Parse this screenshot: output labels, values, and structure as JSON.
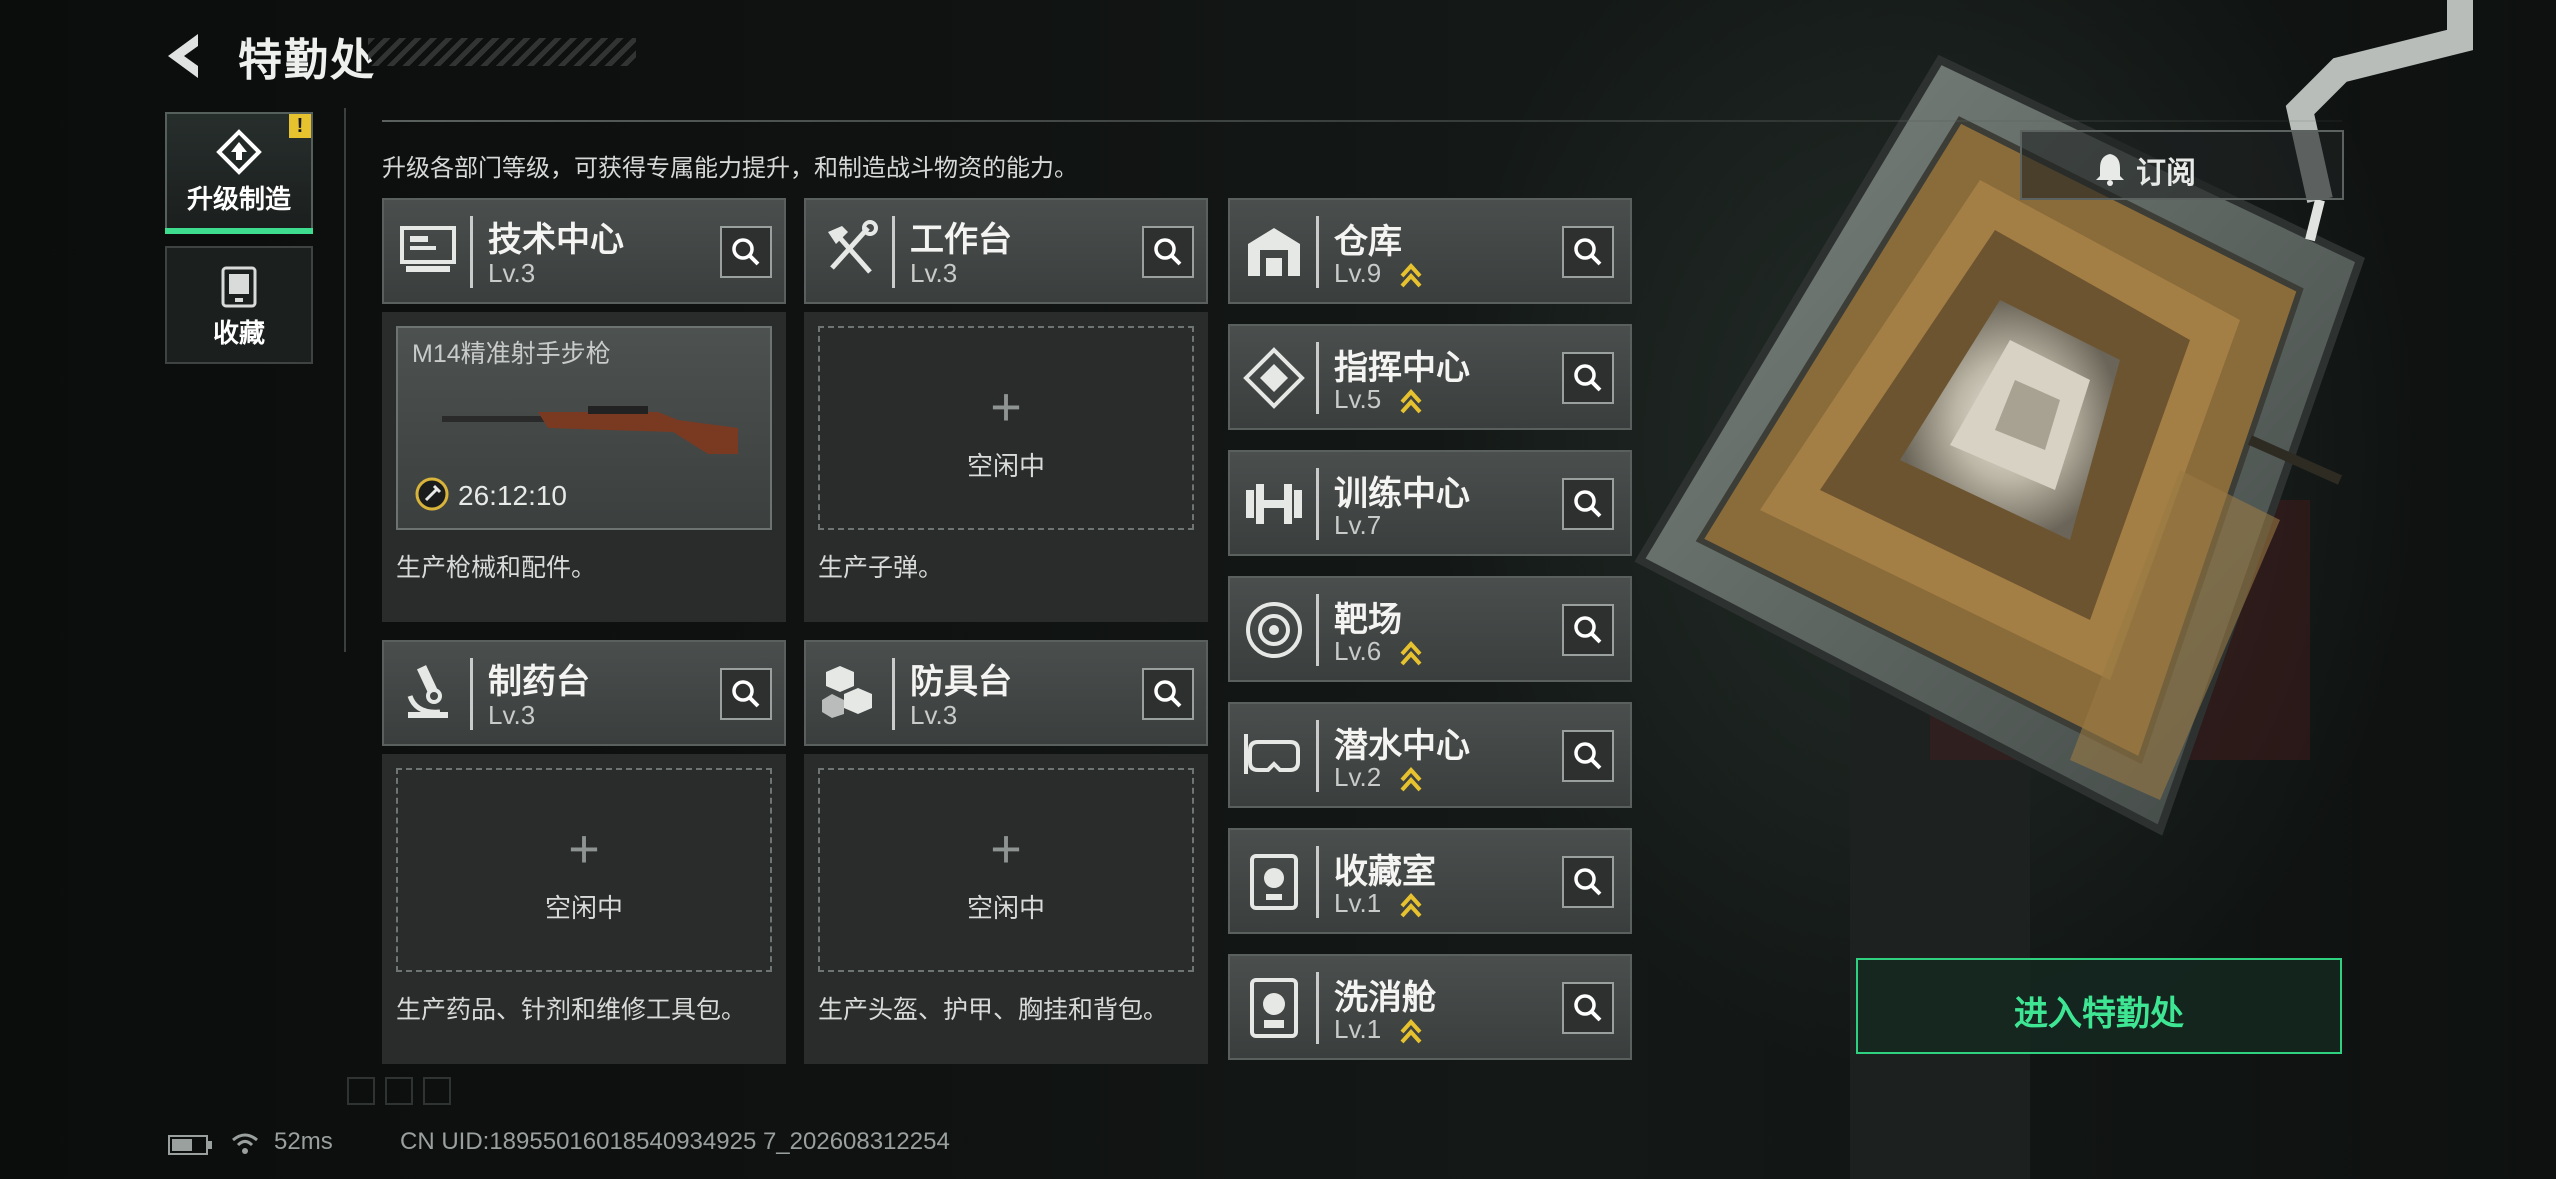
{
  "header": {
    "title": "特勤处"
  },
  "sidebar": {
    "tabs": [
      {
        "label": "升级制造",
        "active": true,
        "alert": "!"
      },
      {
        "label": "收藏",
        "active": false
      }
    ]
  },
  "description": "升级各部门等级，可获得专属能力提升，和制造战斗物资的能力。",
  "workshops": [
    {
      "name": "技术中心",
      "level": "Lv.3",
      "icon": "monitor-icon",
      "status": "busy",
      "item": "M14精准射手步枪",
      "timer": "26:12:10",
      "desc": "生产枪械和配件。"
    },
    {
      "name": "工作台",
      "level": "Lv.3",
      "icon": "tools-icon",
      "status": "idle",
      "idle_label": "空闲中",
      "desc": "生产子弹。"
    },
    {
      "name": "制药台",
      "level": "Lv.3",
      "icon": "microscope-icon",
      "status": "idle",
      "idle_label": "空闲中",
      "desc": "生产药品、针剂和维修工具包。"
    },
    {
      "name": "防具台",
      "level": "Lv.3",
      "icon": "cubes-icon",
      "status": "idle",
      "idle_label": "空闲中",
      "desc": "生产头盔、护甲、胸挂和背包。"
    }
  ],
  "facilities": [
    {
      "name": "仓库",
      "level": "Lv.9",
      "icon": "warehouse-icon",
      "upgradable": true
    },
    {
      "name": "指挥中心",
      "level": "Lv.5",
      "icon": "command-icon",
      "upgradable": true
    },
    {
      "name": "训练中心",
      "level": "Lv.7",
      "icon": "dumbbell-icon",
      "upgradable": false
    },
    {
      "name": "靶场",
      "level": "Lv.6",
      "icon": "target-icon",
      "upgradable": true
    },
    {
      "name": "潜水中心",
      "level": "Lv.2",
      "icon": "diving-mask-icon",
      "upgradable": true
    },
    {
      "name": "收藏室",
      "level": "Lv.1",
      "icon": "trophy-case-icon",
      "upgradable": true
    },
    {
      "name": "洗消舱",
      "level": "Lv.1",
      "icon": "decon-icon",
      "upgradable": true
    }
  ],
  "subscribe": {
    "label": "订阅"
  },
  "enter_button": {
    "label": "进入特勤处"
  },
  "status_bar": {
    "ping": "52ms",
    "uid": "CN UID:18955016018540934925 7_202608312254"
  },
  "colors": {
    "accent_green": "#3ee694",
    "upgrade_gold": "#e7c22f",
    "alert_yellow": "#e7c22f"
  }
}
